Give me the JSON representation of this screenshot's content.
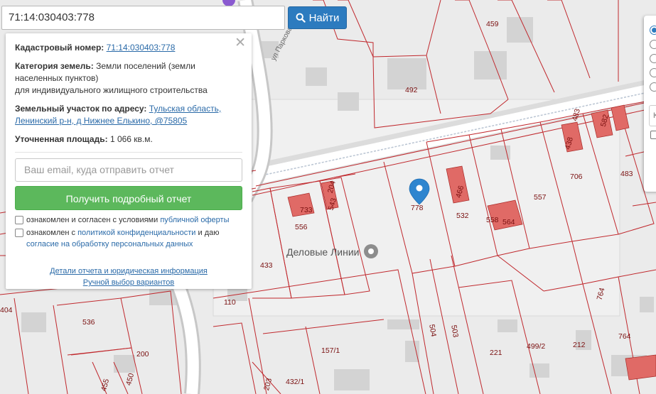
{
  "search": {
    "value": "71:14:030403:778",
    "button_label": "Найти"
  },
  "info_panel": {
    "cadastral_label": "Кадастровый номер:",
    "cadastral_value": "71:14:030403:778",
    "category_label": "Категория земель:",
    "category_value": "Земли поселений (земли населенных пунктов)",
    "category_use": "для индивидуального жилищного строительства",
    "address_label": "Земельный участок по адресу:",
    "address_value": "Тульская область, Ленинский р-н, д Нижнее Елькино, @75805",
    "area_label": "Уточненная площадь:",
    "area_value": "1 066 кв.м.",
    "email_placeholder": "Ваш email, куда отправить отчет",
    "report_button": "Получить подробный отчет",
    "consent1_prefix": "ознакомлен и согласен с условиями ",
    "consent1_link": "публичной оферты",
    "consent2_prefix": "ознакомлен с ",
    "consent2_link": "политикой конфиденциальности",
    "consent2_mid": " и даю ",
    "consent2_link2": "согласие на обработку персональных данных",
    "details_link": "Детали отчета и юридическая информация",
    "manual_link": "Ручной выбор вариантов"
  },
  "map": {
    "street_label": "ул Парковая",
    "poi_label": "Деловые Линии",
    "parcel_labels": [
      "460",
      "459",
      "492",
      "483",
      "582",
      "438",
      "706",
      "483",
      "466",
      "557",
      "778",
      "532",
      "558",
      "564",
      "204",
      "543",
      "733",
      "556",
      "433",
      "110",
      "404",
      "536",
      "200",
      "157/1",
      "504",
      "503",
      "221",
      "499/2",
      "212",
      "764",
      "764",
      "455",
      "450",
      "432/1",
      "203"
    ],
    "colors": {
      "parcel_border": "#c0282d",
      "building_fill": "#e06a66",
      "marker": "#2e85cf",
      "road": "#ffffff"
    }
  },
  "layer_panel": {
    "field_hint": "К"
  }
}
